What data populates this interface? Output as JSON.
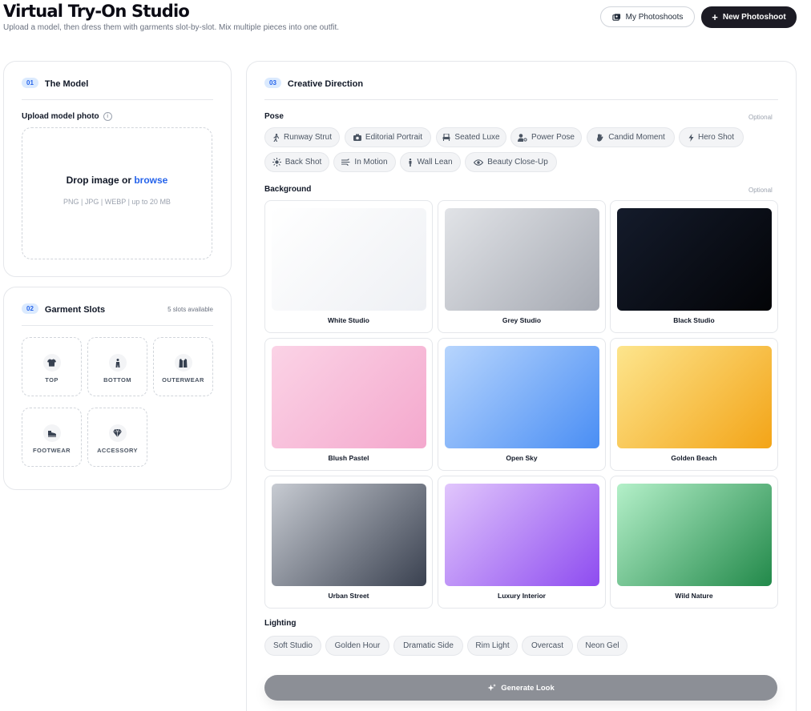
{
  "header": {
    "title": "Virtual Try-On Studio",
    "subtitle": "Upload a model, then dress them with garments slot-by-slot. Mix multiple pieces into one outfit.",
    "my_photoshoots_label": "My Photoshoots",
    "new_photoshoot_label": "New Photoshoot"
  },
  "model_card": {
    "step": "01",
    "title": "The Model",
    "upload_label": "Upload model photo",
    "drop_text": "Drop image or",
    "browse_text": "browse",
    "formats": "PNG | JPG | WEBP | up to 20 MB"
  },
  "slots_card": {
    "step": "02",
    "title": "Garment Slots",
    "available": "5 slots available",
    "slots": [
      {
        "label": "TOP",
        "icon": "shirt-icon"
      },
      {
        "label": "BOTTOM",
        "icon": "pants-icon"
      },
      {
        "label": "OUTERWEAR",
        "icon": "jacket-icon"
      },
      {
        "label": "FOOTWEAR",
        "icon": "shoe-icon"
      },
      {
        "label": "ACCESSORY",
        "icon": "gem-icon"
      }
    ]
  },
  "direction_card": {
    "step": "03",
    "title": "Creative Direction",
    "pose_label": "Pose",
    "pose_optional": "Optional",
    "poses": [
      {
        "label": "Runway Strut",
        "icon": "walking-icon"
      },
      {
        "label": "Editorial Portrait",
        "icon": "camera-icon"
      },
      {
        "label": "Seated Luxe",
        "icon": "armchair-icon"
      },
      {
        "label": "Power Pose",
        "icon": "user-cog-icon"
      },
      {
        "label": "Candid Moment",
        "icon": "hand-wave-icon"
      },
      {
        "label": "Hero Shot",
        "icon": "lightning-icon"
      },
      {
        "label": "Back Shot",
        "icon": "sun-burst-icon"
      },
      {
        "label": "In Motion",
        "icon": "wind-icon"
      },
      {
        "label": "Wall Lean",
        "icon": "standing-person-icon"
      },
      {
        "label": "Beauty Close-Up",
        "icon": "eye-icon"
      }
    ],
    "background_label": "Background",
    "background_optional": "Optional",
    "backgrounds": [
      {
        "name": "White Studio",
        "from": "#ffffff",
        "to": "#eef0f4"
      },
      {
        "name": "Grey Studio",
        "from": "#e1e3e7",
        "to": "#a5a9b2"
      },
      {
        "name": "Black Studio",
        "from": "#141b2b",
        "to": "#030407"
      },
      {
        "name": "Blush Pastel",
        "from": "#fbd3e6",
        "to": "#f4a8cd"
      },
      {
        "name": "Open Sky",
        "from": "#b7d5fd",
        "to": "#4a8ef4"
      },
      {
        "name": "Golden Beach",
        "from": "#fde58d",
        "to": "#f3a417"
      },
      {
        "name": "Urban Street",
        "from": "#c7cbd2",
        "to": "#3a4150"
      },
      {
        "name": "Luxury Interior",
        "from": "#e1c6fc",
        "to": "#8e4cf0"
      },
      {
        "name": "Wild Nature",
        "from": "#b4f0c9",
        "to": "#22894a"
      }
    ],
    "lighting_label": "Lighting",
    "lighting": [
      "Soft Studio",
      "Golden Hour",
      "Dramatic Side",
      "Rim Light",
      "Overcast",
      "Neon Gel"
    ],
    "generate_label": "Generate Look"
  },
  "colors": {
    "accent": "#2563eb",
    "dark_button": "#1c1b24",
    "generate_disabled": "#8c8f96"
  }
}
